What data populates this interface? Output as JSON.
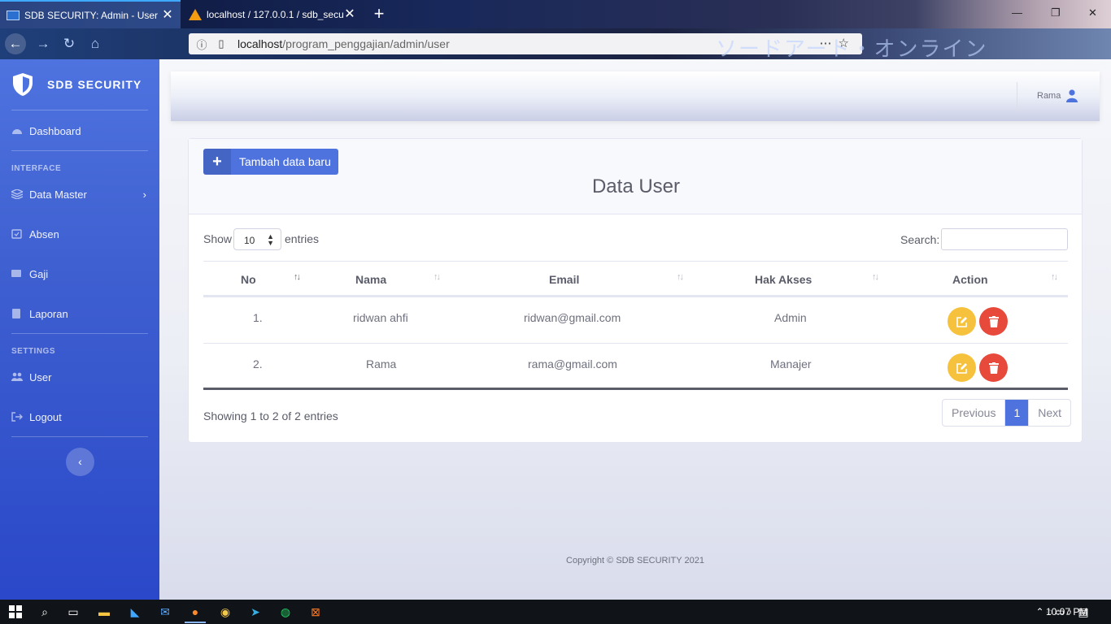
{
  "browser": {
    "tabs": [
      {
        "title": "SDB SECURITY: Admin - User",
        "active": true
      },
      {
        "title": "localhost / 127.0.0.1 / sdb_secu",
        "active": false
      }
    ],
    "url_host": "localhost",
    "url_path": "/program_penggajian/admin/user",
    "decor_text": "ソードアート・オンライン",
    "icons": [
      "back-icon",
      "forward-icon",
      "reload-icon",
      "home-icon",
      "info-icon",
      "page-icon",
      "more-icon",
      "pocket-icon",
      "star-icon"
    ]
  },
  "sidebar": {
    "brand": "SDB SECURITY",
    "dashboard": "Dashboard",
    "heading_interface": "INTERFACE",
    "data_master": "Data Master",
    "absen": "Absen",
    "gaji": "Gaji",
    "laporan": "Laporan",
    "heading_settings": "SETTINGS",
    "user": "User",
    "logout": "Logout"
  },
  "topbar": {
    "user_name": "Rama"
  },
  "card": {
    "add_label": "Tambah data baru",
    "title": "Data User"
  },
  "table_controls": {
    "show_label": "Show",
    "length_value": "10",
    "entries_label": "entries",
    "search_label": "Search:",
    "search_value": ""
  },
  "table": {
    "headers": [
      "No",
      "Nama",
      "Email",
      "Hak Akses",
      "Action"
    ],
    "rows": [
      {
        "no": "1.",
        "nama": "ridwan ahfi",
        "email": "ridwan@gmail.com",
        "hak_akses": "Admin"
      },
      {
        "no": "2.",
        "nama": "Rama",
        "email": "rama@gmail.com",
        "hak_akses": "Manajer"
      }
    ]
  },
  "pagination": {
    "info": "Showing 1 to 2 of 2 entries",
    "previous": "Previous",
    "current": "1",
    "next": "Next"
  },
  "footer": {
    "copyright": "Copyright © SDB SECURITY 2021"
  },
  "taskbar": {
    "clock": "10:07 PM"
  },
  "colors": {
    "primary": "#4e73df",
    "warning": "#f6c23e",
    "danger": "#e74a3b",
    "text": "#5a5c69"
  }
}
